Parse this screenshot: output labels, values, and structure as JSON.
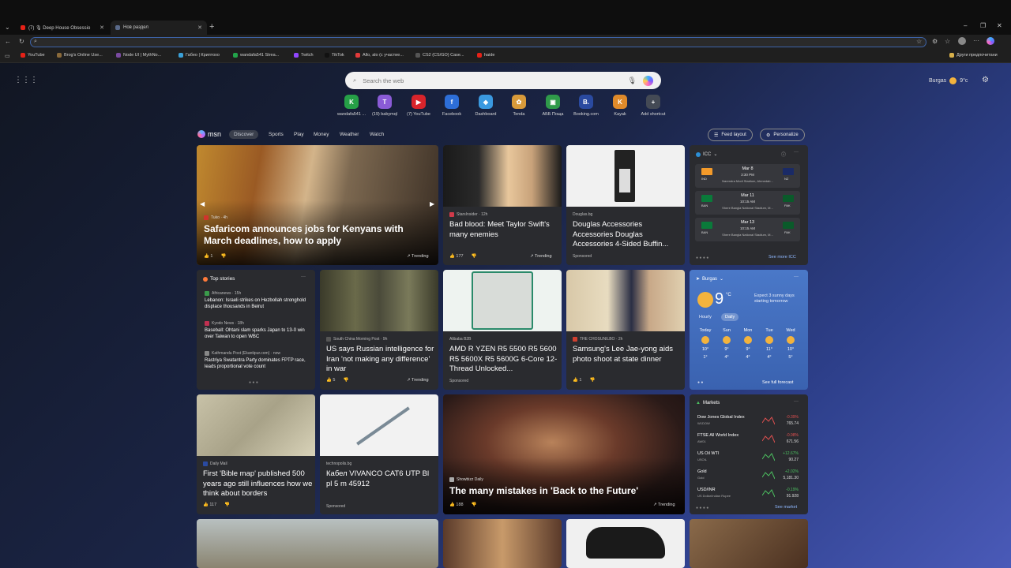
{
  "browser": {
    "tabs": [
      {
        "label": "(7) 🎙 Deep House Obsessio"
      },
      {
        "label": "Нов раздел"
      }
    ],
    "new_tab": "+",
    "bookmarks": [
      {
        "label": "YouTube",
        "color": "#e62117"
      },
      {
        "label": "Brog's Online Use...",
        "color": "#8a6a3a"
      },
      {
        "label": "Node UI | MythNo...",
        "color": "#7a4aa0"
      },
      {
        "label": "Габео | Криптохо",
        "color": "#3aa0d8"
      },
      {
        "label": "wandafa541 Strea...",
        "color": "#22a34a"
      },
      {
        "label": "Twitch",
        "color": "#9146ff"
      },
      {
        "label": "TikTok",
        "color": "#111111"
      },
      {
        "label": "Allo, alo (с участие...",
        "color": "#e23a3a"
      },
      {
        "label": "CS2 (CS/GO) Case...",
        "color": "#555555"
      },
      {
        "label": "haide",
        "color": "#e62117"
      }
    ],
    "other_favorites": "Други предпочитани"
  },
  "newtab": {
    "search_placeholder": "Search the web",
    "weather_city": "Burgas",
    "weather_temp": "9°c",
    "shortcuts": [
      {
        "label": "wandafa541 ...",
        "glyph": "K",
        "color": "#26a047"
      },
      {
        "label": "(19) babymql",
        "glyph": "T",
        "color": "#8a5bd6"
      },
      {
        "label": "(7) YouTube",
        "glyph": "▶",
        "color": "#d8242b"
      },
      {
        "label": "Facebook",
        "glyph": "f",
        "color": "#2d6ed8"
      },
      {
        "label": "Dashboard",
        "glyph": "◆",
        "color": "#3a99e0"
      },
      {
        "label": "Tenda",
        "glyph": "✿",
        "color": "#d89a3a"
      },
      {
        "label": "АББ Поща",
        "glyph": "▣",
        "color": "#2f9a4a"
      },
      {
        "label": "Booking.com",
        "glyph": "B.",
        "color": "#2a4aa0"
      },
      {
        "label": "Kayak",
        "glyph": "K",
        "color": "#e08a2a"
      },
      {
        "label": "Add shortcut",
        "glyph": "+",
        "color": "#444a55"
      }
    ]
  },
  "feed": {
    "brand": "msn",
    "tabs": [
      "Discover",
      "Sports",
      "Play",
      "Money",
      "Weather",
      "Watch"
    ],
    "feed_layout": "Feed layout",
    "personalize": "Personalize",
    "cards": {
      "c1": {
        "source": "Tuko · 4h",
        "title": "Safaricom announces jobs for Kenyans with March deadlines, how to apply",
        "likes": "1",
        "trend": "Trending"
      },
      "c2": {
        "source": "StarsInsider · 12h",
        "title": "Bad blood: Meet Taylor Swift's many enemies",
        "likes": "177",
        "trend": "Trending"
      },
      "c3": {
        "source": "Douglas.bg",
        "title": "Douglas Accessories Accessories Douglas Accessories 4-Sided Buffin...",
        "sponsored": "Sponsored"
      },
      "c5": {
        "source": "South China Morning Post · 9h",
        "title": "US says Russian intelligence for Iran 'not making any difference' in war",
        "likes": "5",
        "trend": "Trending"
      },
      "c6": {
        "source": "Alibaba B2B",
        "title": "AMD R YZEN R5 5500 R5 5600 R5 5600X R5 5600G 6-Core 12-Thread Unlocked...",
        "sponsored": "Sponsored"
      },
      "c7": {
        "source": "THE CHOSUNILBO · 2h",
        "title": "Samsung's Lee Jae-yong aids photo shoot at state dinner",
        "likes": "1"
      },
      "c8": {
        "source": "Daily Mail",
        "title": "First 'Bible map' published 500 years ago still influences how we think about borders",
        "likes": "117"
      },
      "c9": {
        "source": "technopolis.bg",
        "title": "Кабел VIVANCO CAT6 UTP Bl pl 5 m 45912",
        "sponsored": "Sponsored"
      },
      "c10": {
        "source": "Showbizz Daily",
        "title": "The many mistakes in 'Back to the Future'",
        "likes": "188",
        "trend": "Trending"
      }
    },
    "top_stories": {
      "header": "Top stories",
      "items": [
        {
          "source": "Africanews · 15h",
          "title": "Lebanon: Israeli strikes on Hezbollah stronghold displace thousands in Beirut"
        },
        {
          "source": "Kyodo News · 18h",
          "title": "Baseball: Ohtani slam sparks Japan to 13-0 win over Taiwan to open WBC"
        },
        {
          "source": "Kathmandu Post (Ekantipur.com) · now",
          "title": "Rastriya Swatantra Party dominates FPTP race, leads proportional vote count"
        }
      ]
    },
    "cricket": {
      "header": "ICC",
      "see_more": "See more ICC",
      "matches": [
        {
          "date": "Mar 8",
          "time": "3:30 PM",
          "team1": "IND",
          "team2": "NZ",
          "venue": "Narendra Modi Stadium, Ahmedab...",
          "c1": "#f39a2a",
          "c2": "#1a2a66"
        },
        {
          "date": "Mar 11",
          "time": "10:15 AM",
          "team1": "BAN",
          "team2": "PAK",
          "venue": "Shere Bangla National Stadium, M...",
          "c1": "#0a7a3a",
          "c2": "#0a5a2a"
        },
        {
          "date": "Mar 13",
          "time": "10:15 AM",
          "team1": "BAN",
          "team2": "PAK",
          "venue": "Shere Bangla National Stadium, M...",
          "c1": "#0a7a3a",
          "c2": "#0a5a2a"
        }
      ]
    },
    "weather": {
      "city": "Burgas",
      "temp": "9",
      "unit": "°C",
      "note": "Expect 3 sunny days starting tomorrow",
      "toggle": [
        "Hourly",
        "Daily"
      ],
      "days": [
        {
          "d": "Today",
          "hi": "10°",
          "lo": "1°"
        },
        {
          "d": "Sun",
          "hi": "9°",
          "lo": "4°"
        },
        {
          "d": "Mon",
          "hi": "9°",
          "lo": "4°"
        },
        {
          "d": "Tue",
          "hi": "11°",
          "lo": "4°"
        },
        {
          "d": "Wed",
          "hi": "10°",
          "lo": "5°"
        }
      ],
      "see_full": "See full forecast"
    },
    "markets": {
      "header": "Markets",
      "see_market": "See market",
      "rows": [
        {
          "name": "Dow Jones Global Index",
          "sym": "W1DOW",
          "chg": "-0.39%",
          "val": "765.74",
          "color": "#e05050"
        },
        {
          "name": "FTSE All World Index",
          "sym": "AW01",
          "chg": "-0.98%",
          "val": "671.56",
          "color": "#e05050"
        },
        {
          "name": "US Oil WTI",
          "sym": "USOIL",
          "chg": "+12.67%",
          "val": "90.27",
          "color": "#4cc060"
        },
        {
          "name": "Gold",
          "sym": "Gold",
          "chg": "+2.02%",
          "val": "5,181.30",
          "color": "#4cc060"
        },
        {
          "name": "USD/INR",
          "sym": "US Dollar/Indian Rupee",
          "chg": "-0.19%",
          "val": "91.928",
          "color": "#4cc060"
        }
      ]
    }
  }
}
